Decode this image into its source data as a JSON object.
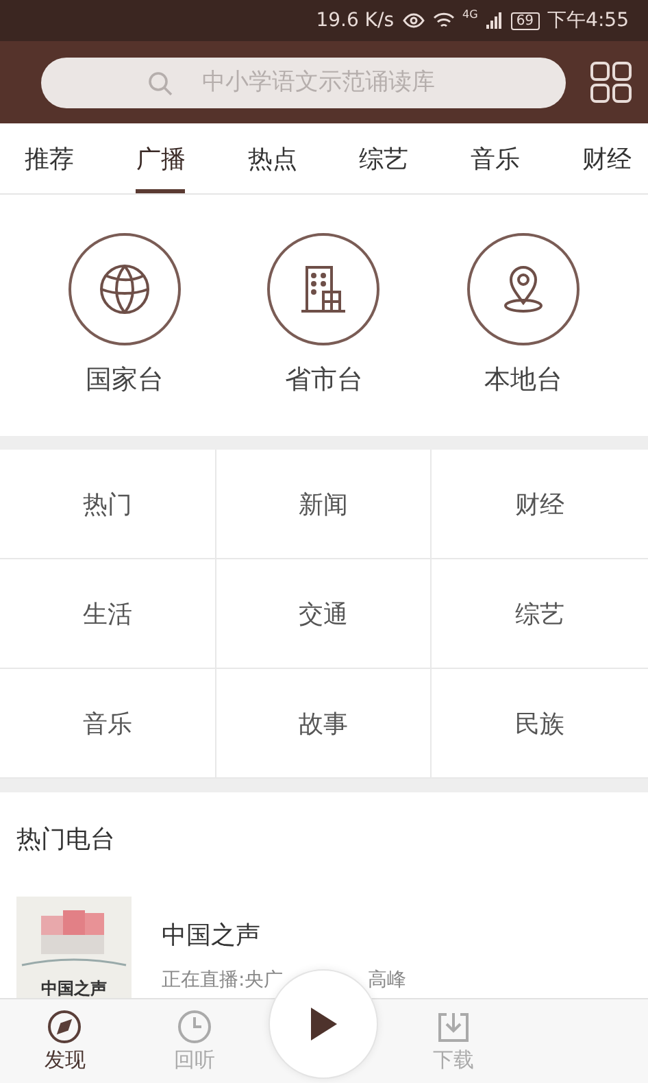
{
  "status_bar": {
    "speed": "19.6 K/s",
    "network": "4G",
    "battery": "69",
    "time": "下午4:55"
  },
  "search": {
    "placeholder": "中小学语文示范诵读库"
  },
  "tabs": [
    {
      "label": "推荐",
      "selected": false
    },
    {
      "label": "广播",
      "selected": true
    },
    {
      "label": "热点",
      "selected": false
    },
    {
      "label": "综艺",
      "selected": false
    },
    {
      "label": "音乐",
      "selected": false
    },
    {
      "label": "财经",
      "selected": false
    }
  ],
  "station_types": [
    {
      "kind": "globe",
      "label": "国家台"
    },
    {
      "kind": "building",
      "label": "省市台"
    },
    {
      "kind": "pin",
      "label": "本地台"
    }
  ],
  "categories": [
    "热门",
    "新闻",
    "财经",
    "生活",
    "交通",
    "综艺",
    "音乐",
    "故事",
    "民族"
  ],
  "hot_section": {
    "title": "热门电台",
    "stations": [
      {
        "logo_text": "中国之声",
        "name": "中国之声",
        "status": "正在直播:央广",
        "status_tail": "高峰"
      }
    ]
  },
  "bottom_nav": [
    {
      "kind": "compass",
      "label": "发现",
      "selected": true
    },
    {
      "kind": "clock",
      "label": "回听",
      "selected": false
    },
    {
      "kind": "play"
    },
    {
      "kind": "download",
      "label": "下载",
      "selected": false
    }
  ]
}
